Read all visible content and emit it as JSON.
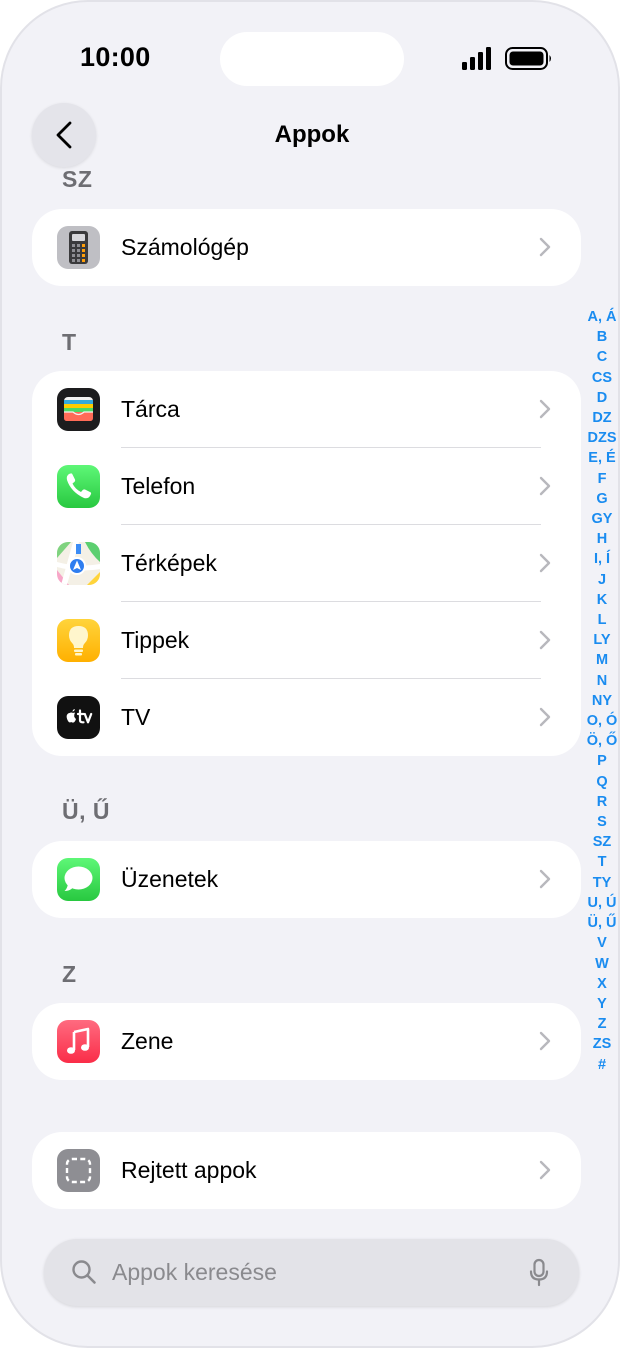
{
  "status_bar": {
    "time": "10:00"
  },
  "nav": {
    "title": "Appok"
  },
  "sections": [
    {
      "header": "SZ",
      "apps": [
        {
          "label": "Számológép",
          "icon": "calculator-icon"
        }
      ]
    },
    {
      "header": "T",
      "apps": [
        {
          "label": "Tárca",
          "icon": "wallet-icon"
        },
        {
          "label": "Telefon",
          "icon": "phone-icon"
        },
        {
          "label": "Térképek",
          "icon": "maps-icon"
        },
        {
          "label": "Tippek",
          "icon": "tips-icon"
        },
        {
          "label": "TV",
          "icon": "tv-icon"
        }
      ]
    },
    {
      "header": "Ü, Ű",
      "apps": [
        {
          "label": "Üzenetek",
          "icon": "messages-icon"
        }
      ]
    },
    {
      "header": "Z",
      "apps": [
        {
          "label": "Zene",
          "icon": "music-icon"
        }
      ]
    }
  ],
  "hidden_apps": {
    "label": "Rejtett appok",
    "icon": "hidden-apps-icon"
  },
  "index": [
    "A, Á",
    "B",
    "C",
    "CS",
    "D",
    "DZ",
    "DZS",
    "E, É",
    "F",
    "G",
    "GY",
    "H",
    "I, Í",
    "J",
    "K",
    "L",
    "LY",
    "M",
    "N",
    "NY",
    "O, Ó",
    "Ö, Ő",
    "P",
    "Q",
    "R",
    "S",
    "SZ",
    "T",
    "TY",
    "U, Ú",
    "Ü, Ű",
    "V",
    "W",
    "X",
    "Y",
    "Z",
    "ZS",
    "#"
  ],
  "search": {
    "placeholder": "Appok keresése"
  },
  "colors": {
    "accent": "#1a8cf0",
    "background": "#f2f2f7"
  }
}
